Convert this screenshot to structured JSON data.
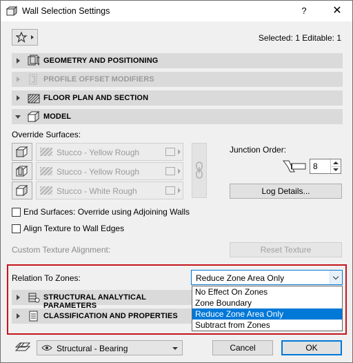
{
  "window": {
    "title": "Wall Selection Settings",
    "help_label": "?",
    "close_label": "✕"
  },
  "header": {
    "selected_info": "Selected: 1 Editable: 1"
  },
  "panels": [
    {
      "label": "GEOMETRY AND POSITIONING",
      "state": "collapsed",
      "enabled": true
    },
    {
      "label": "PROFILE OFFSET MODIFIERS",
      "state": "collapsed",
      "enabled": false
    },
    {
      "label": "FLOOR PLAN AND SECTION",
      "state": "collapsed",
      "enabled": true
    },
    {
      "label": "MODEL",
      "state": "expanded",
      "enabled": true
    },
    {
      "label": "STRUCTURAL ANALYTICAL PARAMETERS",
      "state": "collapsed",
      "enabled": true
    },
    {
      "label": "CLASSIFICATION AND PROPERTIES",
      "state": "collapsed",
      "enabled": true
    }
  ],
  "model": {
    "override_surfaces_label": "Override Surfaces:",
    "surfaces": [
      {
        "icon": "wall-outside-face-icon",
        "material": "Stucco - Yellow Rough"
      },
      {
        "icon": "wall-inside-face-icon",
        "material": "Stucco - Yellow Rough"
      },
      {
        "icon": "wall-edge-face-icon",
        "material": "Stucco - White Rough"
      }
    ],
    "junction_order_label": "Junction Order:",
    "junction_order_value": "8",
    "log_details_label": "Log Details...",
    "end_surfaces_label": "End Surfaces: Override using Adjoining Walls",
    "align_texture_label": "Align Texture to Wall Edges",
    "custom_texture_label": "Custom Texture Alignment:",
    "reset_texture_label": "Reset Texture",
    "relation_to_zones_label": "Relation To Zones:",
    "relation_to_zones_value": "Reduce Zone Area Only",
    "relation_options": [
      "No Effect On Zones",
      "Zone Boundary",
      "Reduce Zone Area Only",
      "Subtract from Zones"
    ],
    "relation_selected_index": 2
  },
  "footer": {
    "structural_function": "Structural - Bearing",
    "cancel_label": "Cancel",
    "ok_label": "OK"
  },
  "colors": {
    "highlight_frame": "#c4151c",
    "selection": "#0078d7",
    "panel_header": "#dadada"
  }
}
